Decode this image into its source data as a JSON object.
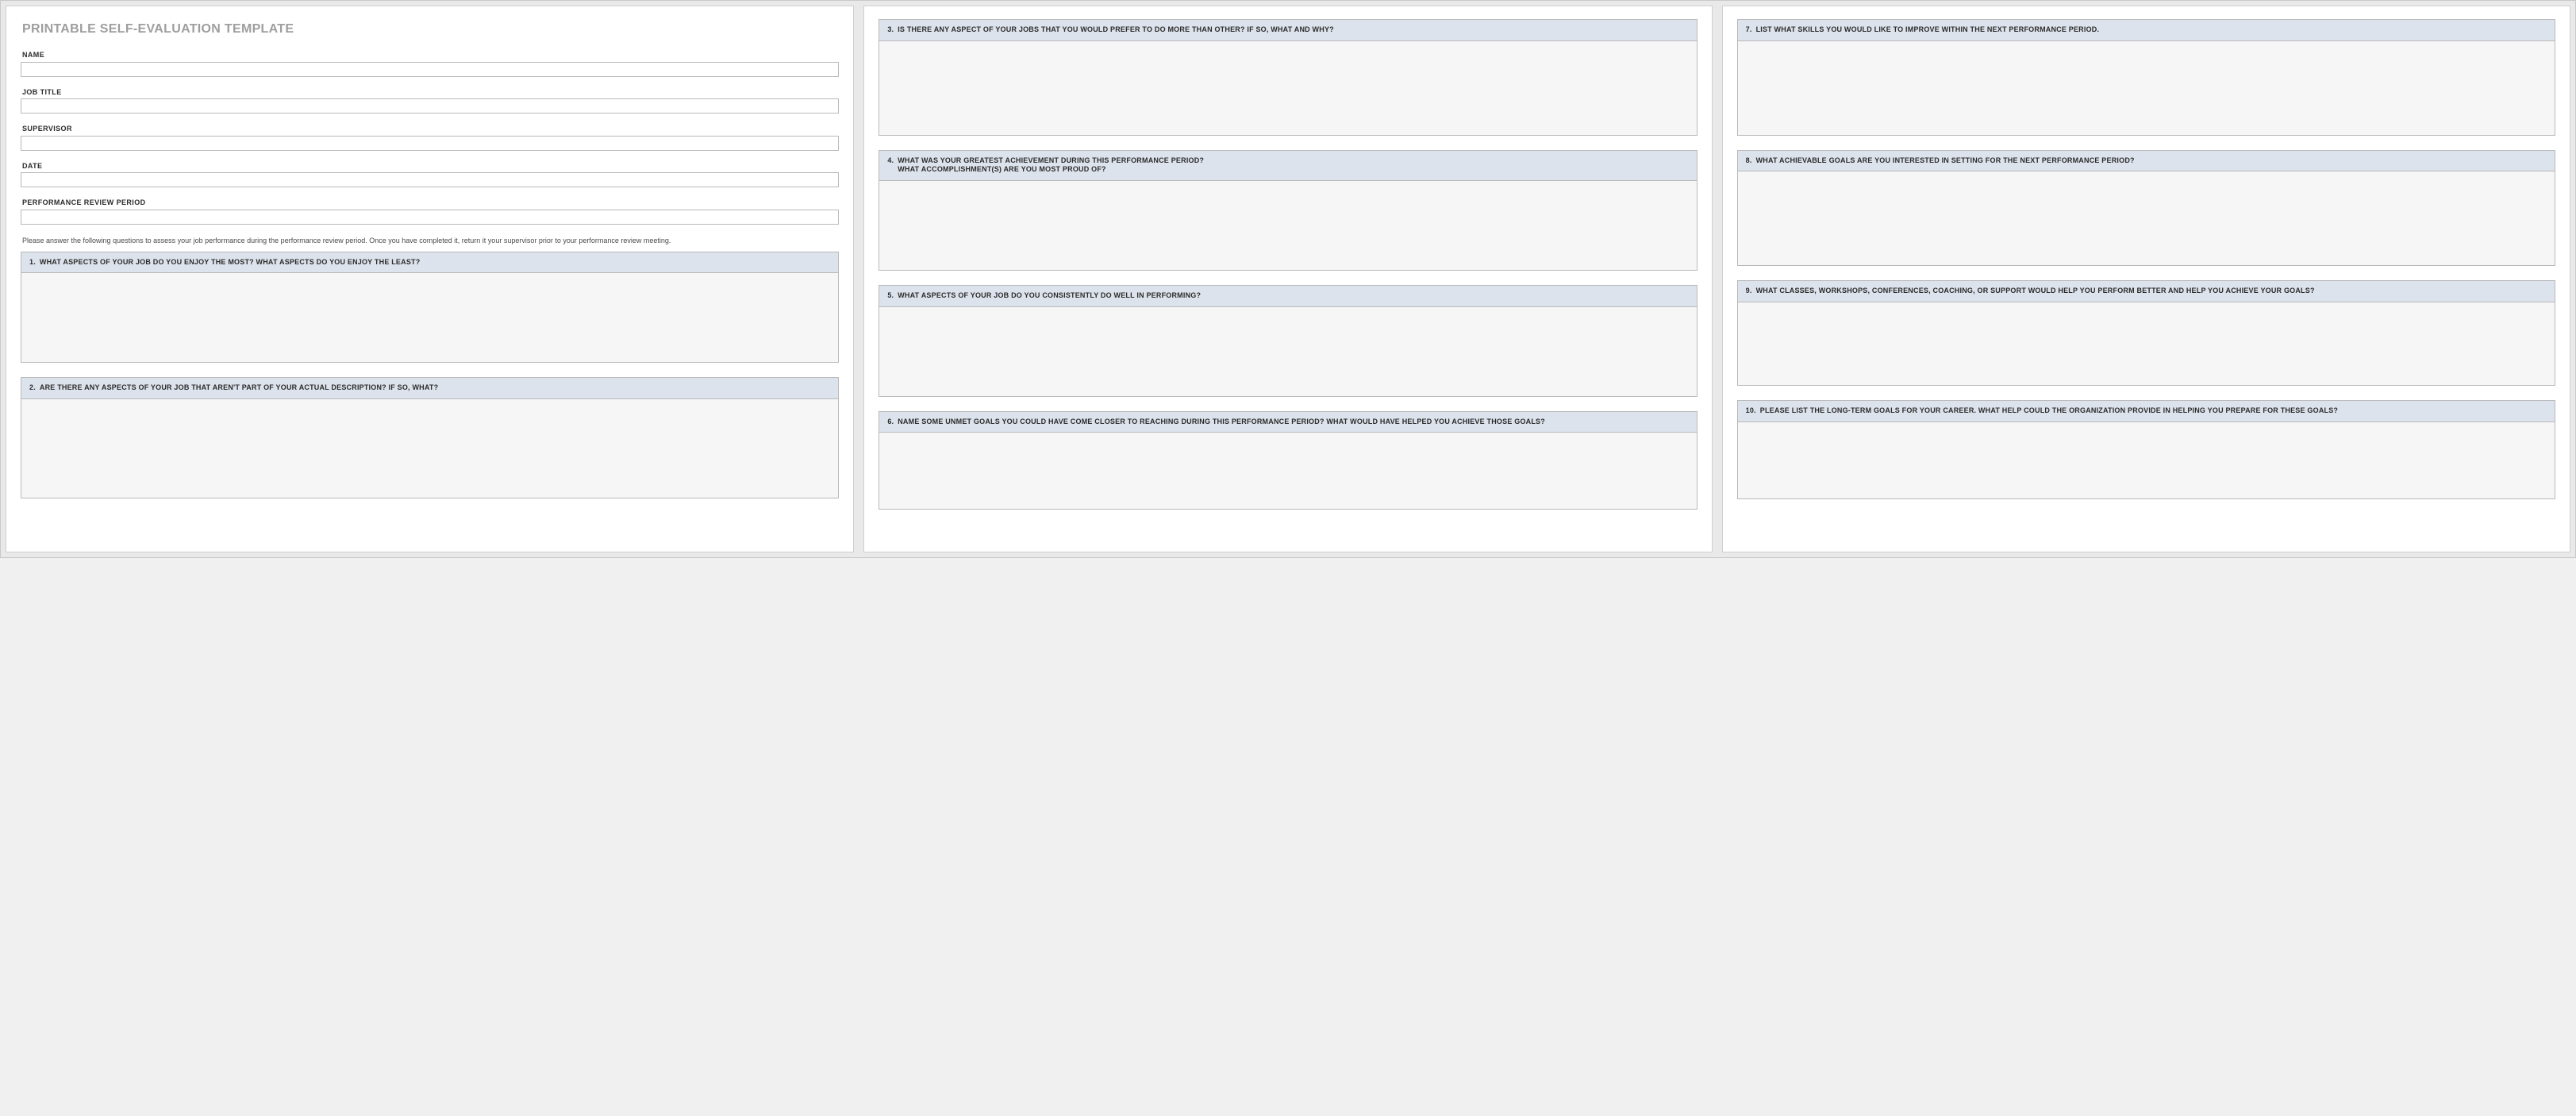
{
  "title": "PRINTABLE SELF-EVALUATION TEMPLATE",
  "fields": {
    "name": {
      "label": "NAME",
      "value": ""
    },
    "job": {
      "label": "JOB TITLE",
      "value": ""
    },
    "sup": {
      "label": "SUPERVISOR",
      "value": ""
    },
    "date": {
      "label": "DATE",
      "value": ""
    },
    "period": {
      "label": "PERFORMANCE REVIEW PERIOD",
      "value": ""
    }
  },
  "instructions": "Please answer the following questions to assess your job performance during the performance review period. Once you have completed it, return it your supervisor prior to your performance review meeting.",
  "questions": {
    "q1": {
      "num": "1.",
      "text": "WHAT ASPECTS OF YOUR JOB DO YOU ENJOY THE MOST? WHAT ASPECTS DO YOU ENJOY THE LEAST?",
      "answer": ""
    },
    "q2": {
      "num": "2.",
      "text": "ARE THERE ANY ASPECTS OF YOUR JOB THAT AREN'T PART OF YOUR ACTUAL DESCRIPTION? IF SO, WHAT?",
      "answer": ""
    },
    "q3": {
      "num": "3.",
      "text": "IS THERE ANY ASPECT OF YOUR JOBS THAT YOU WOULD PREFER TO DO MORE THAN OTHER? IF SO, WHAT AND WHY?",
      "answer": ""
    },
    "q4": {
      "num": "4.",
      "text": "WHAT WAS YOUR GREATEST ACHIEVEMENT DURING THIS PERFORMANCE PERIOD?\nWHAT ACCOMPLISHMENT(S) ARE YOU MOST PROUD OF?",
      "answer": ""
    },
    "q5": {
      "num": "5.",
      "text": "WHAT ASPECTS OF YOUR JOB DO YOU CONSISTENTLY DO WELL IN PERFORMING?",
      "answer": ""
    },
    "q6": {
      "num": "6.",
      "text": "NAME SOME UNMET GOALS YOU COULD HAVE COME CLOSER TO REACHING DURING THIS PERFORMANCE PERIOD? WHAT WOULD HAVE HELPED YOU ACHIEVE THOSE GOALS?",
      "answer": ""
    },
    "q7": {
      "num": "7.",
      "text": "LIST WHAT SKILLS YOU WOULD LIKE TO IMPROVE WITHIN THE NEXT PERFORMANCE PERIOD.",
      "answer": ""
    },
    "q8": {
      "num": "8.",
      "text": "WHAT ACHIEVABLE GOALS ARE YOU INTERESTED IN SETTING FOR THE NEXT PERFORMANCE PERIOD?",
      "answer": ""
    },
    "q9": {
      "num": "9.",
      "text": "WHAT CLASSES, WORKSHOPS, CONFERENCES, COACHING, OR SUPPORT WOULD HELP YOU PERFORM BETTER AND HELP YOU ACHIEVE YOUR GOALS?",
      "answer": ""
    },
    "q10": {
      "num": "10.",
      "text": "PLEASE LIST THE LONG-TERM GOALS FOR YOUR CAREER. WHAT HELP COULD THE ORGANIZATION PROVIDE IN HELPING YOU PREPARE FOR THESE GOALS?",
      "answer": ""
    }
  }
}
